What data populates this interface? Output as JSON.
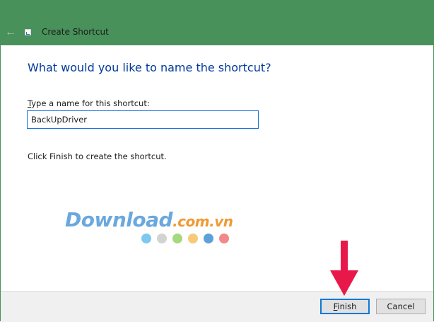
{
  "window": {
    "title": "Create Shortcut"
  },
  "page": {
    "heading": "What would you like to name the shortcut?",
    "field_label_accel": "T",
    "field_label_rest": "ype a name for this shortcut:",
    "name_value": "BackUpDriver",
    "hint": "Click Finish to create the shortcut."
  },
  "buttons": {
    "finish_accel": "F",
    "finish_rest": "inish",
    "cancel": "Cancel"
  },
  "watermark": {
    "brand": "Download",
    "suffix": ".com.vn",
    "dot_colors": [
      "#7ec8ef",
      "#d3d3d3",
      "#a6d97e",
      "#f7c97a",
      "#5ea0d8",
      "#f08a8a"
    ]
  },
  "colors": {
    "titlebar": "#49915a",
    "heading": "#003a9a",
    "focus_border": "#0f78d7",
    "annotation_arrow": "#e8194a"
  },
  "icons": {
    "back": "back-arrow-icon",
    "app": "shortcut-icon"
  }
}
